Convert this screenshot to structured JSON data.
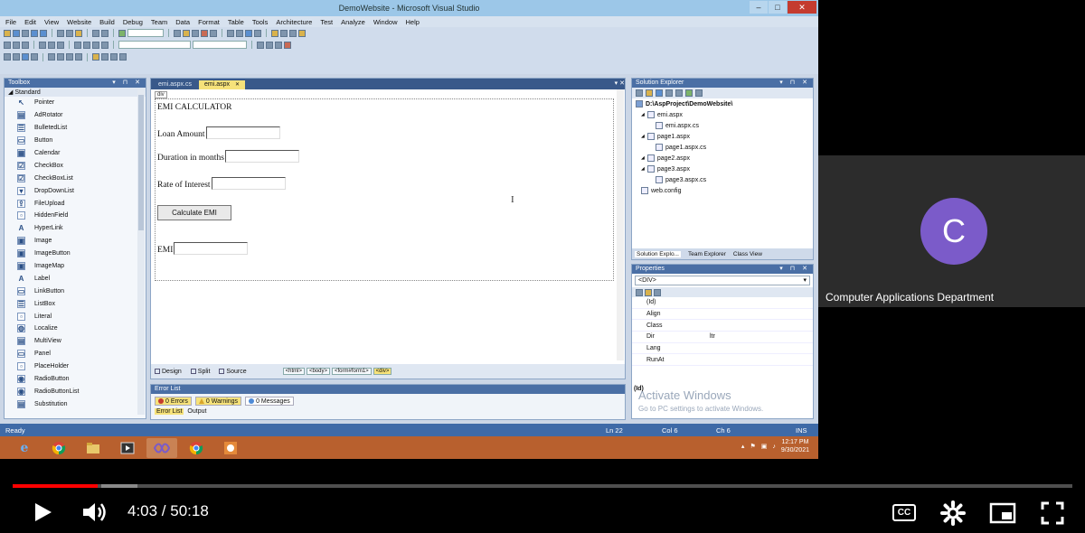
{
  "vs": {
    "title": "DemoWebsite - Microsoft Visual Studio",
    "menu": [
      "File",
      "Edit",
      "View",
      "Website",
      "Build",
      "Debug",
      "Team",
      "Data",
      "Format",
      "Table",
      "Tools",
      "Architecture",
      "Test",
      "Analyze",
      "Window",
      "Help"
    ],
    "toolbox": {
      "title": "Toolbox",
      "group": "Standard",
      "items": [
        "Pointer",
        "AdRotator",
        "BulletedList",
        "Button",
        "Calendar",
        "CheckBox",
        "CheckBoxList",
        "DropDownList",
        "FileUpload",
        "HiddenField",
        "HyperLink",
        "Image",
        "ImageButton",
        "ImageMap",
        "Label",
        "LinkButton",
        "ListBox",
        "Literal",
        "Localize",
        "MultiView",
        "Panel",
        "PlaceHolder",
        "RadioButton",
        "RadioButtonList",
        "Substitution"
      ]
    },
    "editor": {
      "tabs": [
        "emi.aspx.cs",
        "emi.aspx"
      ],
      "div_tag": "div",
      "heading": "EMI CALCULATOR",
      "loan_label": "Loan Amount",
      "duration_label": "Duration in months",
      "rate_label": "Rate of Interest",
      "calc_button": "Calculate EMI",
      "emi_label": "EMI",
      "views": [
        "Design",
        "Split",
        "Source"
      ],
      "breadcrumbs": [
        "<html>",
        "<body>",
        "<form#form1>",
        "<div>"
      ]
    },
    "solution_explorer": {
      "title": "Solution Explorer",
      "root": "D:\\AspProject\\DemoWebsite\\",
      "files": [
        {
          "name": "emi.aspx",
          "level": 1
        },
        {
          "name": "emi.aspx.cs",
          "level": 2
        },
        {
          "name": "page1.aspx",
          "level": 1
        },
        {
          "name": "page1.aspx.cs",
          "level": 2
        },
        {
          "name": "page2.aspx",
          "level": 1
        },
        {
          "name": "page3.aspx",
          "level": 1
        },
        {
          "name": "page3.aspx.cs",
          "level": 2
        },
        {
          "name": "web.config",
          "level": 1
        }
      ],
      "bottom_tabs": [
        "Solution Explo...",
        "Team Explorer",
        "Class View"
      ]
    },
    "properties": {
      "title": "Properties",
      "selected": "<DIV>",
      "rows": [
        {
          "name": "(Id)",
          "value": ""
        },
        {
          "name": "Align",
          "value": ""
        },
        {
          "name": "Class",
          "value": ""
        },
        {
          "name": "Dir",
          "value": "ltr"
        },
        {
          "name": "Lang",
          "value": ""
        },
        {
          "name": "RunAt",
          "value": ""
        }
      ],
      "footer_title": "(Id)"
    },
    "watermark": {
      "line1": "Activate Windows",
      "line2": "Go to PC settings to activate Windows."
    },
    "error_list": {
      "title": "Error List",
      "errors": "0 Errors",
      "warnings": "0 Warnings",
      "messages": "0 Messages",
      "bottom_tabs": [
        "Error List",
        "Output"
      ]
    },
    "status": {
      "ready": "Ready",
      "ln": "Ln 22",
      "col": "Col 6",
      "ch": "Ch 6",
      "ins": "INS"
    },
    "clock": {
      "time": "12:17 PM",
      "date": "9/30/2021"
    }
  },
  "meeting": {
    "initial": "C",
    "name": "Computer Applications Department",
    "avatar_color": "#7b5bc9"
  },
  "player": {
    "current": "4:03",
    "duration": "50:18",
    "time_display": "4:03 / 50:18",
    "progress_fraction": 0.0805,
    "cc_label": "CC"
  }
}
